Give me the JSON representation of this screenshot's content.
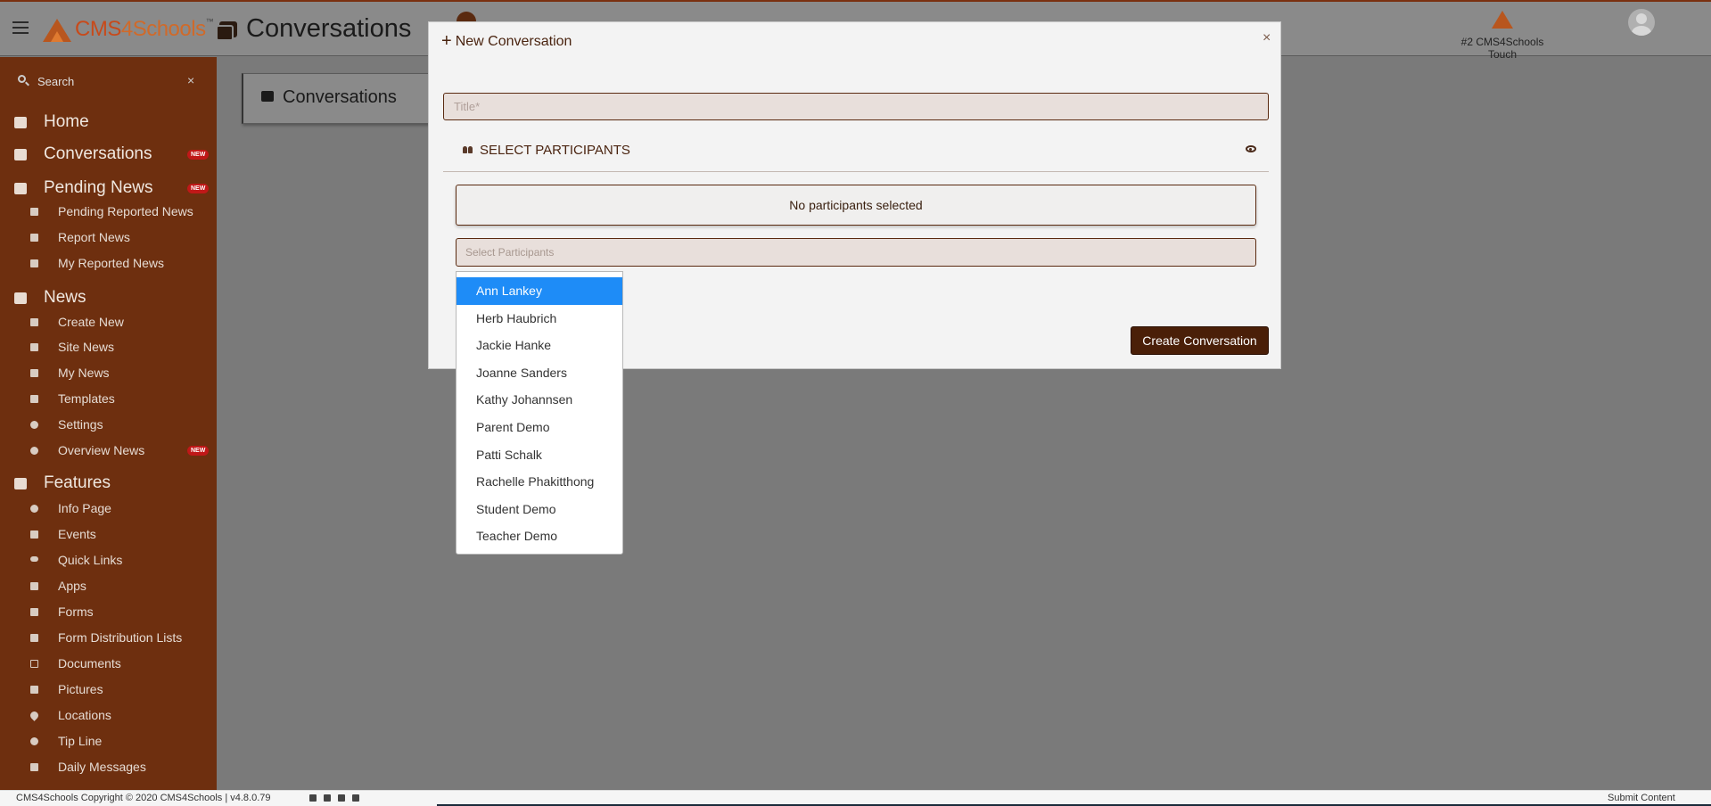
{
  "header": {
    "brand_part1": "CMS",
    "brand_part2": "4Schools",
    "trademark": "™",
    "page_title": "Conversations",
    "school_label": "#2 CMS4Schools Touch"
  },
  "sidebar": {
    "search_placeholder": "Search",
    "search_clear": "×",
    "badge_new": "NEW",
    "items": [
      {
        "label": "Home",
        "icon": "home-icon"
      },
      {
        "label": "Conversations",
        "icon": "chat-icon",
        "badge": "NEW"
      },
      {
        "label": "Pending News",
        "icon": "paper-plane-icon",
        "badge": "NEW"
      },
      {
        "label": "Pending Reported News",
        "icon": "reply-icon"
      },
      {
        "label": "Report News",
        "icon": "plus-icon"
      },
      {
        "label": "My Reported News",
        "icon": "user-icon"
      },
      {
        "label": "News",
        "icon": "comment-icon"
      },
      {
        "label": "Create New",
        "icon": "plus-icon"
      },
      {
        "label": "Site News",
        "icon": "newspaper-icon"
      },
      {
        "label": "My News",
        "icon": "user-icon"
      },
      {
        "label": "Templates",
        "icon": "template-icon"
      },
      {
        "label": "Settings",
        "icon": "gear-icon"
      },
      {
        "label": "Overview News",
        "icon": "search-icon",
        "badge": "NEW"
      },
      {
        "label": "Features",
        "icon": "cube-icon"
      },
      {
        "label": "Info Page",
        "icon": "info-icon"
      },
      {
        "label": "Events",
        "icon": "calendar-icon"
      },
      {
        "label": "Quick Links",
        "icon": "link-icon"
      },
      {
        "label": "Apps",
        "icon": "grid-icon"
      },
      {
        "label": "Forms",
        "icon": "form-icon"
      },
      {
        "label": "Form Distribution Lists",
        "icon": "list-icon"
      },
      {
        "label": "Documents",
        "icon": "document-icon"
      },
      {
        "label": "Pictures",
        "icon": "image-icon"
      },
      {
        "label": "Locations",
        "icon": "map-pin-icon"
      },
      {
        "label": "Tip Line",
        "icon": "speech-bubble-icon"
      },
      {
        "label": "Daily Messages",
        "icon": "calendar-icon"
      }
    ]
  },
  "content": {
    "card_title": "Conversations"
  },
  "modal": {
    "title_plus": "+",
    "title": "New Conversation",
    "close": "×",
    "title_placeholder": "Title*",
    "select_participants_label": "SELECT PARTICIPANTS",
    "no_participants": "No participants selected",
    "participants_placeholder": "Select Participants",
    "create_button": "Create Conversation"
  },
  "dropdown": {
    "options": [
      "Ann Lankey",
      "Herb Haubrich",
      "Jackie Hanke",
      "Joanne Sanders",
      "Kathy Johannsen",
      "Parent Demo",
      "Patti Schalk",
      "Rachelle Phakitthong",
      "Student Demo",
      "Teacher Demo"
    ],
    "highlighted": "Ann Lankey"
  },
  "footer": {
    "copyright": "CMS4Schools Copyright © 2020 CMS4Schools | v4.8.0.79",
    "submit_content": "Submit Content"
  },
  "colors": {
    "sidebar": "#6e2f0f",
    "brand_orange": "#c84a1a",
    "modal_button": "#4a1f08",
    "dropdown_highlight": "#1e8cf7",
    "badge_red": "#c01818"
  }
}
